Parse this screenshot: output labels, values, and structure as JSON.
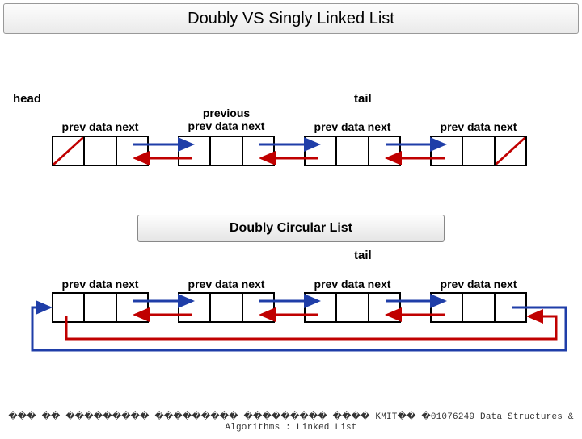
{
  "title": "Doubly VS Singly Linked List",
  "labels": {
    "head": "head",
    "tail1": "tail",
    "tail2": "tail",
    "previous": "previous",
    "cells": "prev data next"
  },
  "sub_title": "Doubly Circular List",
  "footer": {
    "placeholders": "��� �� ��������� ��������� ��������� ���� KMIT�� �01076249 Data Structures & Algorithms : Linked List"
  },
  "diagram": {
    "row1_nodes": 4,
    "row2_nodes": 4,
    "null_slash_cells": [
      "row1_node1_prev",
      "row1_node4_next"
    ]
  }
}
